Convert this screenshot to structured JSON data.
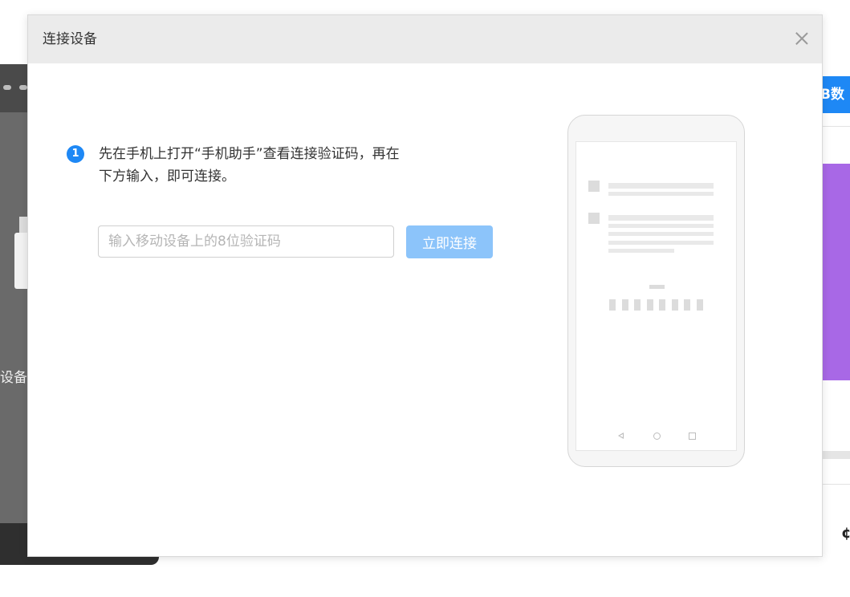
{
  "background": {
    "left_panel_text": "设备",
    "right_button_text": "B数",
    "right_banner_color": "#a868e6",
    "right_button_color": "#1e88f5"
  },
  "dialog": {
    "title": "连接设备",
    "close_icon": "close-icon",
    "step": {
      "number": "1",
      "line1": "先在手机上打开“手机助手”查看连接验证码，再在",
      "line2": "下方输入，即可连接。"
    },
    "code_input": {
      "placeholder": "输入移动设备上的8位验证码",
      "value": ""
    },
    "connect_button": "立即连接",
    "accent_color": "#1e88f5"
  },
  "phone_illustration": {
    "nav_icons": [
      "back-triangle-icon",
      "home-circle-icon",
      "recent-square-icon"
    ]
  }
}
